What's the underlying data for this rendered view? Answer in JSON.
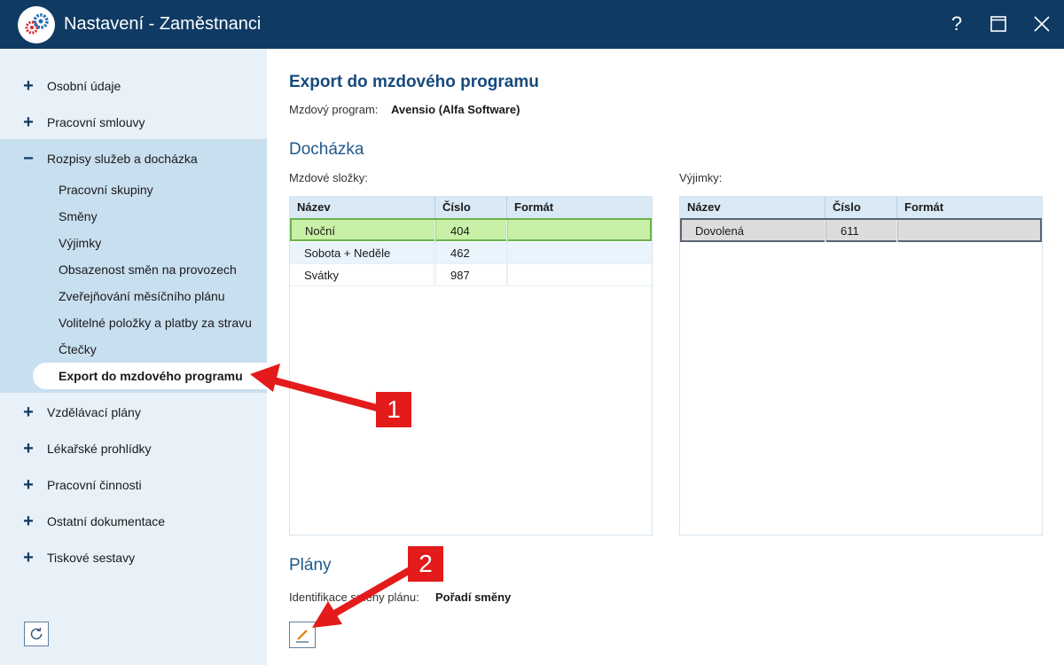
{
  "window": {
    "title": "Nastavení - Zaměstnanci",
    "help_label": "?",
    "app_icon": "gears-icon"
  },
  "sidebar": {
    "groups": [
      {
        "label": "Osobní údaje",
        "state": "+"
      },
      {
        "label": "Pracovní smlouvy",
        "state": "+"
      },
      {
        "label": "Rozpisy služeb a docházka",
        "state": "−"
      },
      {
        "label": "Vzdělávací plány",
        "state": "+"
      },
      {
        "label": "Lékařské prohlídky",
        "state": "+"
      },
      {
        "label": "Pracovní činnosti",
        "state": "+"
      },
      {
        "label": "Ostatní dokumentace",
        "state": "+"
      },
      {
        "label": "Tiskové sestavy",
        "state": "+"
      }
    ],
    "subitems": [
      "Pracovní skupiny",
      "Směny",
      "Výjimky",
      "Obsazenost směn na provozech",
      "Zveřejňování měsíčního plánu",
      "Volitelné položky a platby za stravu",
      "Čtečky",
      "Export do mzdového programu"
    ],
    "active_subitem": "Export do mzdového programu"
  },
  "main": {
    "title": "Export do mzdového programu",
    "payroll_label": "Mzdový program:",
    "payroll_value": "Avensio (Alfa Software)",
    "attendance": {
      "title": "Docházka",
      "components_label": "Mzdové složky:",
      "exceptions_label": "Výjimky:",
      "columns": [
        "Název",
        "Číslo",
        "Formát"
      ],
      "components_rows": [
        {
          "name": "Noční",
          "number": "404",
          "format": ""
        },
        {
          "name": "Sobota + Neděle",
          "number": "462",
          "format": ""
        },
        {
          "name": "Svátky",
          "number": "987",
          "format": ""
        }
      ],
      "exceptions_rows": [
        {
          "name": "Dovolená",
          "number": "611",
          "format": ""
        }
      ]
    },
    "plans": {
      "title": "Plány",
      "shift_id_label": "Identifikace směny plánu:",
      "shift_id_value": "Pořadí směny"
    }
  },
  "annotations": {
    "callout_1": "1",
    "callout_2": "2",
    "color": "#e31b1b"
  },
  "colors": {
    "titlebar": "#0f3a63",
    "sidebar": "#e8f1f8",
    "sidebar_expanded": "#c8dff0",
    "selected_row": "#c8f0a6",
    "accent": "#174a7c"
  }
}
